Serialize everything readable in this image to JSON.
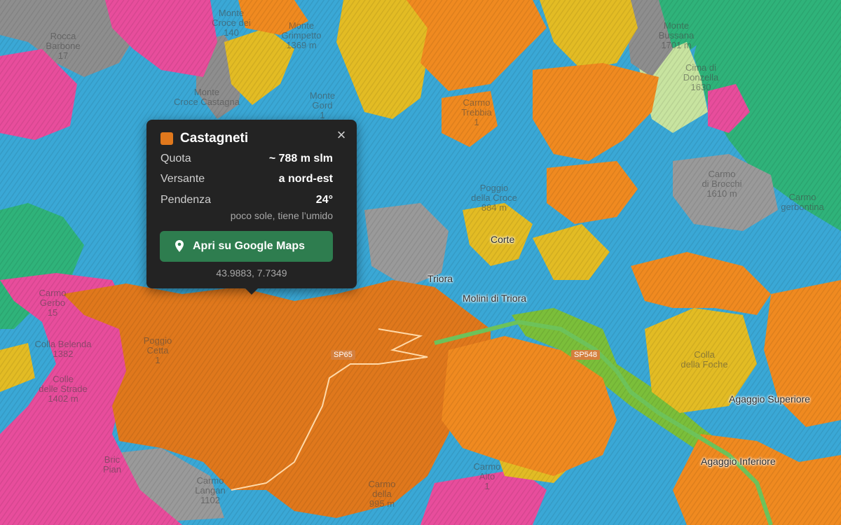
{
  "map": {
    "place_labels": [
      {
        "id": "monte-croce-dei",
        "text": "Monte\nCroce dei\n140"
      },
      {
        "id": "monte-grimpetto",
        "text": "Monte\nGrimpetto\n1369 m"
      },
      {
        "id": "rocca-barbone",
        "text": "Rocca\nBarbone\n17"
      },
      {
        "id": "monte-croce-castagna",
        "text": "Monte\nCroce Castagna"
      },
      {
        "id": "monte-gord",
        "text": "Monte\nGord\n1"
      },
      {
        "id": "monte-bussana",
        "text": "Monte\nBussana\n1701 m"
      },
      {
        "id": "cima-donzella",
        "text": "Cima di\nDonzella\n1630"
      },
      {
        "id": "carmo-di-brocchi",
        "text": "Carmo\ndi Brocchi\n1610 m"
      },
      {
        "id": "carmo-gerbontina",
        "text": "Carmo\ngerbontina"
      },
      {
        "id": "poggio-della-croce",
        "text": "Poggio\ndella Croce\n884 m"
      },
      {
        "id": "colla-belenda",
        "text": "Colla Belenda\n1382"
      },
      {
        "id": "colle-strade",
        "text": "Colle\ndelle Strade\n1402 m"
      },
      {
        "id": "carmo-gerbo",
        "text": "Carmo\nGerbo\n15"
      },
      {
        "id": "poggio-cetta",
        "text": "Poggio\nCetta\n1"
      },
      {
        "id": "bric-pian",
        "text": "Bric\nPian"
      },
      {
        "id": "carmo-langan",
        "text": "Carmo\nLangan\n1102"
      },
      {
        "id": "carmo-della-stella",
        "text": "Carmo\ndella\n995 m"
      },
      {
        "id": "carmo-alto",
        "text": "Carmo\nAlto\n1"
      },
      {
        "id": "colla-della-foche",
        "text": "Colla\ndella Foche"
      },
      {
        "id": "carmo-trebbia",
        "text": "Carmo\nTrebbia\n1"
      }
    ],
    "towns": [
      {
        "id": "triora",
        "text": "Triora"
      },
      {
        "id": "molini-di-triora",
        "text": "Molini di Triora"
      },
      {
        "id": "corte",
        "text": "Corte"
      },
      {
        "id": "agaggio-superiore",
        "text": "Agaggio Superiore"
      },
      {
        "id": "agaggio-inferiore",
        "text": "Agaggio Inferiore"
      }
    ],
    "roads": [
      {
        "id": "sp65",
        "text": "SP65"
      },
      {
        "id": "sp548",
        "text": "SP548"
      }
    ],
    "colors": {
      "water_blue": "#3aa8d6",
      "chestnut_orange": "#e0781c",
      "mixed_orange": "#f08a20",
      "pink": "#e84d9c",
      "yellow": "#e3bc24",
      "grey": "#8e8e8e",
      "green": "#2fb37a",
      "lime": "#7bbf3a",
      "light_green": "#c8e4a0"
    }
  },
  "popup": {
    "swatch_color": "#e0781c",
    "title": "Castagneti",
    "close_label": "×",
    "rows": [
      {
        "key": "Quota",
        "value": "~ 788 m slm"
      },
      {
        "key": "Versante",
        "value": "a nord-est"
      },
      {
        "key": "Pendenza",
        "value": "24°"
      }
    ],
    "note": "poco sole, tiene l’umido",
    "button_label": "Apri su Google Maps",
    "button_icon": "map-pin-icon",
    "coords": "43.9883, 7.7349"
  }
}
